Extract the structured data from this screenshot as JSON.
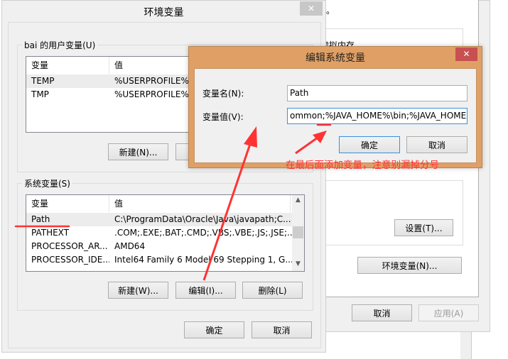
{
  "background_window": {
    "partial_text_top": "。",
    "partial_text_vmem": "虚拟内存",
    "settings_button": "设置(T)...",
    "env_vars_button": "环境变量(N)...",
    "cancel_button": "取消",
    "apply_button": "应用(A)"
  },
  "env_dialog": {
    "title": "环境变量",
    "close": "✕",
    "user_group_label": "bai 的用户变量(U)",
    "columns": [
      "变量",
      "值"
    ],
    "user_vars": [
      {
        "name": "TEMP",
        "value": "%USERPROFILE%\\"
      },
      {
        "name": "TMP",
        "value": "%USERPROFILE%\\"
      }
    ],
    "user_new_button": "新建(N)...",
    "system_group_label": "系统变量(S)",
    "system_vars": [
      {
        "name": "Path",
        "value": "C:\\ProgramData\\Oracle\\Java\\javapath;C..."
      },
      {
        "name": "PATHEXT",
        "value": ".COM;.EXE;.BAT;.CMD;.VBS;.VBE;.JS;.JSE;..."
      },
      {
        "name": "PROCESSOR_AR...",
        "value": "AMD64"
      },
      {
        "name": "PROCESSOR_IDE...",
        "value": "Intel64 Family 6 Model 69 Stepping 1, G..."
      }
    ],
    "system_new_button": "新建(W)...",
    "system_edit_button": "编辑(I)...",
    "system_delete_button": "删除(L)",
    "ok_button": "确定",
    "cancel_button": "取消"
  },
  "edit_dialog": {
    "title": "编辑系统变量",
    "close": "✕",
    "name_label": "变量名(N):",
    "name_value": "Path",
    "value_label": "变量值(V):",
    "value_value": "ommon;%JAVA_HOME%\\bin;%JAVA_HOME",
    "ok_button": "确定",
    "cancel_button": "取消",
    "title_bar_color": "#e0a065",
    "close_color": "#c75050"
  },
  "annotation": {
    "text": "在最后面添加变量，注意别漏掉分号",
    "color": "#ff3333"
  }
}
